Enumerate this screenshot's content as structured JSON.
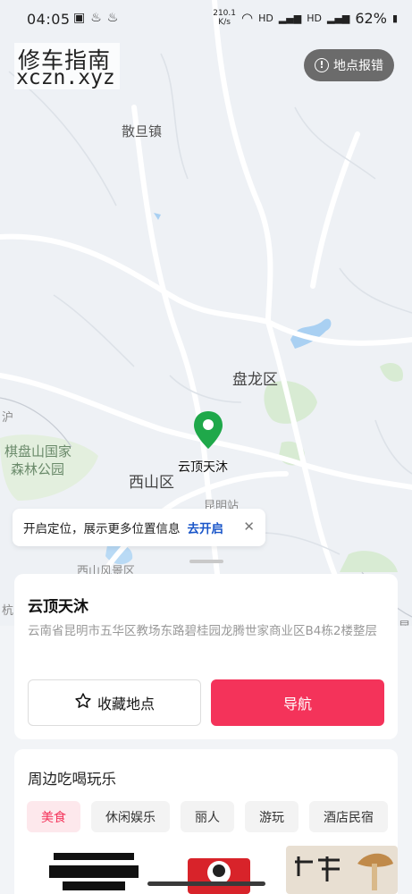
{
  "status_bar": {
    "time": "04:05",
    "net_speed_value": "210.1",
    "net_speed_unit": "K/s",
    "signal_1": "HD",
    "signal_2": "HD",
    "battery": "62%"
  },
  "watermark": {
    "cn": "修车指南",
    "en": "xczn.xyz"
  },
  "report_button": {
    "label": "地点报错",
    "icon": "info-icon"
  },
  "map": {
    "labels": {
      "sandan": "散旦镇",
      "panlong": "盘龙区",
      "qipan": "棋盘山国家",
      "forest": "森林公园",
      "xishan": "西山区",
      "kunming_station": "昆明站",
      "xishan_scenic": "西山风景区",
      "edge_left": "沪",
      "edge_left2": "杭",
      "edge_right": "昆"
    },
    "pin": {
      "label": "云顶天沐",
      "color": "#1fa84a",
      "icon": "location-pin-icon"
    }
  },
  "location_banner": {
    "text": "开启定位，展示更多位置信息",
    "action": "去开启",
    "close_icon": "close-icon"
  },
  "place": {
    "name": "云顶天沐",
    "address": "云南省昆明市五华区教场东路碧桂园龙腾世家商业区B4栋2楼整层",
    "favorite_label": "收藏地点",
    "favorite_icon": "star-icon",
    "navigate_label": "导航",
    "accent_color": "#f4335a"
  },
  "nearby": {
    "title": "周边吃喝玩乐",
    "tabs": [
      "美食",
      "休闲娱乐",
      "丽人",
      "游玩",
      "酒店民宿"
    ],
    "active_tab": "美食"
  }
}
